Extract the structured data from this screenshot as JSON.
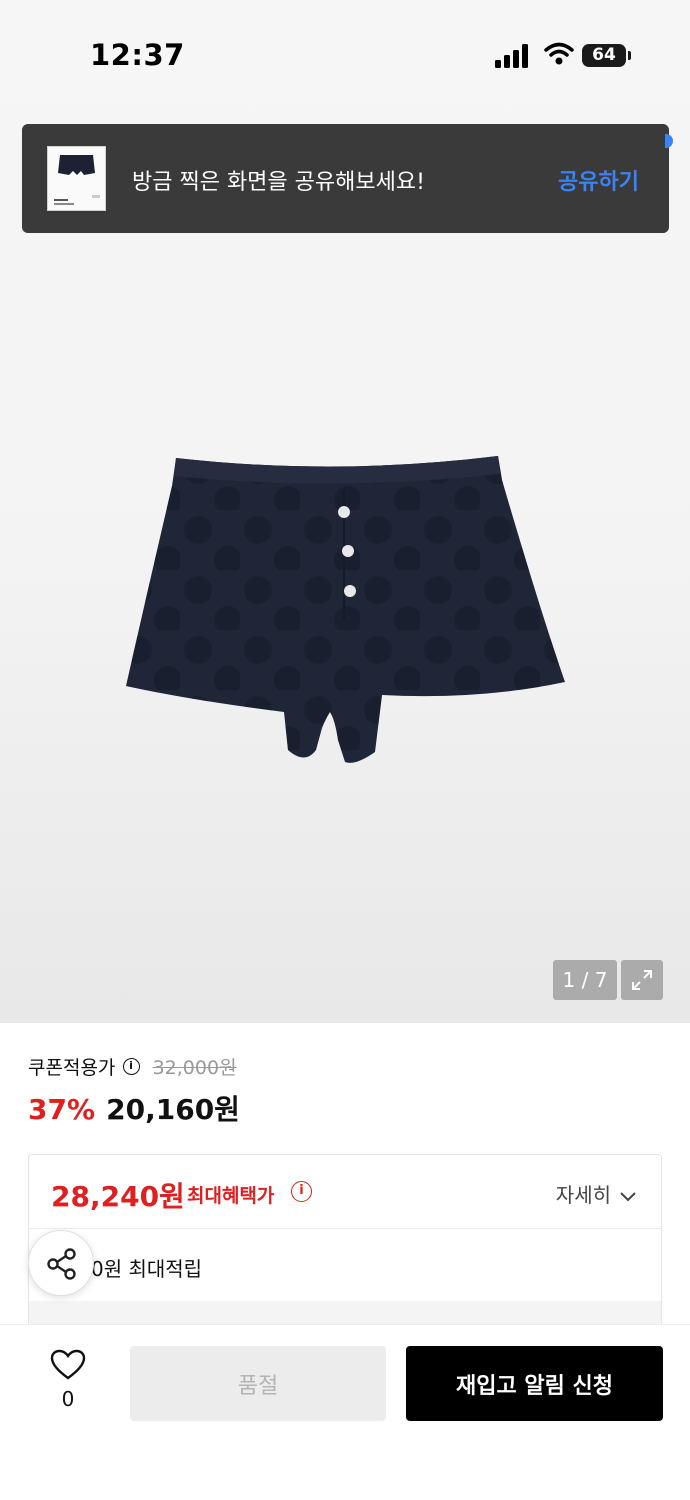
{
  "status_bar": {
    "time": "12:37",
    "battery": "64"
  },
  "share_toast": {
    "message": "방금 찍은 화면을 공유해보세요!",
    "action": "공유하기",
    "accent_color": "#3b82f6"
  },
  "gallery": {
    "counter": "1 / 7"
  },
  "price": {
    "coupon_label": "쿠폰적용가",
    "info_icon": "i",
    "original": "32,000원",
    "discount_rate": "37%",
    "sale": "20,160원"
  },
  "benefits": {
    "max_price": "28,240원",
    "max_label": "최대혜택가",
    "info_icon": "i",
    "detail_toggle": "자세히",
    "points": "0원 최대적립"
  },
  "bottom_bar": {
    "like_count": "0",
    "soldout_label": "품절",
    "restock_label": "재입고 알림 신청"
  },
  "colors": {
    "sale_red": "#e02020",
    "primary_black": "#000000"
  }
}
